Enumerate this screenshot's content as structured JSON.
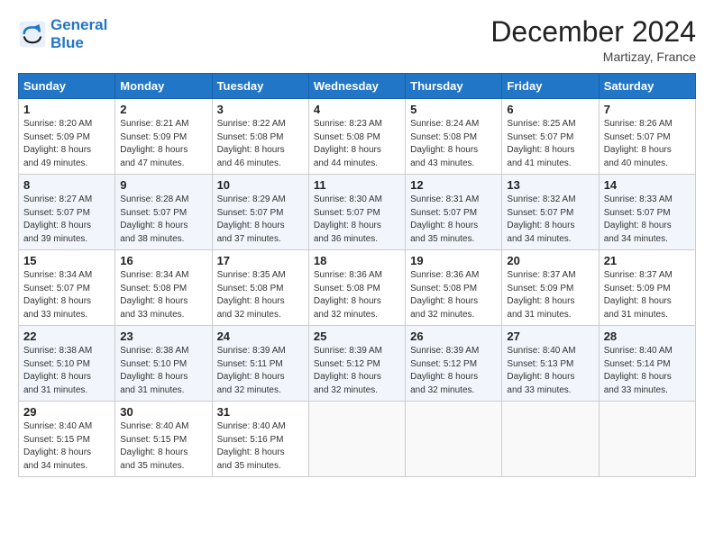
{
  "logo": {
    "line1": "General",
    "line2": "Blue"
  },
  "title": "December 2024",
  "subtitle": "Martizay, France",
  "days_header": [
    "Sunday",
    "Monday",
    "Tuesday",
    "Wednesday",
    "Thursday",
    "Friday",
    "Saturday"
  ],
  "weeks": [
    [
      {
        "day": "1",
        "info": "Sunrise: 8:20 AM\nSunset: 5:09 PM\nDaylight: 8 hours\nand 49 minutes."
      },
      {
        "day": "2",
        "info": "Sunrise: 8:21 AM\nSunset: 5:09 PM\nDaylight: 8 hours\nand 47 minutes."
      },
      {
        "day": "3",
        "info": "Sunrise: 8:22 AM\nSunset: 5:08 PM\nDaylight: 8 hours\nand 46 minutes."
      },
      {
        "day": "4",
        "info": "Sunrise: 8:23 AM\nSunset: 5:08 PM\nDaylight: 8 hours\nand 44 minutes."
      },
      {
        "day": "5",
        "info": "Sunrise: 8:24 AM\nSunset: 5:08 PM\nDaylight: 8 hours\nand 43 minutes."
      },
      {
        "day": "6",
        "info": "Sunrise: 8:25 AM\nSunset: 5:07 PM\nDaylight: 8 hours\nand 41 minutes."
      },
      {
        "day": "7",
        "info": "Sunrise: 8:26 AM\nSunset: 5:07 PM\nDaylight: 8 hours\nand 40 minutes."
      }
    ],
    [
      {
        "day": "8",
        "info": "Sunrise: 8:27 AM\nSunset: 5:07 PM\nDaylight: 8 hours\nand 39 minutes."
      },
      {
        "day": "9",
        "info": "Sunrise: 8:28 AM\nSunset: 5:07 PM\nDaylight: 8 hours\nand 38 minutes."
      },
      {
        "day": "10",
        "info": "Sunrise: 8:29 AM\nSunset: 5:07 PM\nDaylight: 8 hours\nand 37 minutes."
      },
      {
        "day": "11",
        "info": "Sunrise: 8:30 AM\nSunset: 5:07 PM\nDaylight: 8 hours\nand 36 minutes."
      },
      {
        "day": "12",
        "info": "Sunrise: 8:31 AM\nSunset: 5:07 PM\nDaylight: 8 hours\nand 35 minutes."
      },
      {
        "day": "13",
        "info": "Sunrise: 8:32 AM\nSunset: 5:07 PM\nDaylight: 8 hours\nand 34 minutes."
      },
      {
        "day": "14",
        "info": "Sunrise: 8:33 AM\nSunset: 5:07 PM\nDaylight: 8 hours\nand 34 minutes."
      }
    ],
    [
      {
        "day": "15",
        "info": "Sunrise: 8:34 AM\nSunset: 5:07 PM\nDaylight: 8 hours\nand 33 minutes."
      },
      {
        "day": "16",
        "info": "Sunrise: 8:34 AM\nSunset: 5:08 PM\nDaylight: 8 hours\nand 33 minutes."
      },
      {
        "day": "17",
        "info": "Sunrise: 8:35 AM\nSunset: 5:08 PM\nDaylight: 8 hours\nand 32 minutes."
      },
      {
        "day": "18",
        "info": "Sunrise: 8:36 AM\nSunset: 5:08 PM\nDaylight: 8 hours\nand 32 minutes."
      },
      {
        "day": "19",
        "info": "Sunrise: 8:36 AM\nSunset: 5:08 PM\nDaylight: 8 hours\nand 32 minutes."
      },
      {
        "day": "20",
        "info": "Sunrise: 8:37 AM\nSunset: 5:09 PM\nDaylight: 8 hours\nand 31 minutes."
      },
      {
        "day": "21",
        "info": "Sunrise: 8:37 AM\nSunset: 5:09 PM\nDaylight: 8 hours\nand 31 minutes."
      }
    ],
    [
      {
        "day": "22",
        "info": "Sunrise: 8:38 AM\nSunset: 5:10 PM\nDaylight: 8 hours\nand 31 minutes."
      },
      {
        "day": "23",
        "info": "Sunrise: 8:38 AM\nSunset: 5:10 PM\nDaylight: 8 hours\nand 31 minutes."
      },
      {
        "day": "24",
        "info": "Sunrise: 8:39 AM\nSunset: 5:11 PM\nDaylight: 8 hours\nand 32 minutes."
      },
      {
        "day": "25",
        "info": "Sunrise: 8:39 AM\nSunset: 5:12 PM\nDaylight: 8 hours\nand 32 minutes."
      },
      {
        "day": "26",
        "info": "Sunrise: 8:39 AM\nSunset: 5:12 PM\nDaylight: 8 hours\nand 32 minutes."
      },
      {
        "day": "27",
        "info": "Sunrise: 8:40 AM\nSunset: 5:13 PM\nDaylight: 8 hours\nand 33 minutes."
      },
      {
        "day": "28",
        "info": "Sunrise: 8:40 AM\nSunset: 5:14 PM\nDaylight: 8 hours\nand 33 minutes."
      }
    ],
    [
      {
        "day": "29",
        "info": "Sunrise: 8:40 AM\nSunset: 5:15 PM\nDaylight: 8 hours\nand 34 minutes."
      },
      {
        "day": "30",
        "info": "Sunrise: 8:40 AM\nSunset: 5:15 PM\nDaylight: 8 hours\nand 35 minutes."
      },
      {
        "day": "31",
        "info": "Sunrise: 8:40 AM\nSunset: 5:16 PM\nDaylight: 8 hours\nand 35 minutes."
      },
      null,
      null,
      null,
      null
    ]
  ]
}
